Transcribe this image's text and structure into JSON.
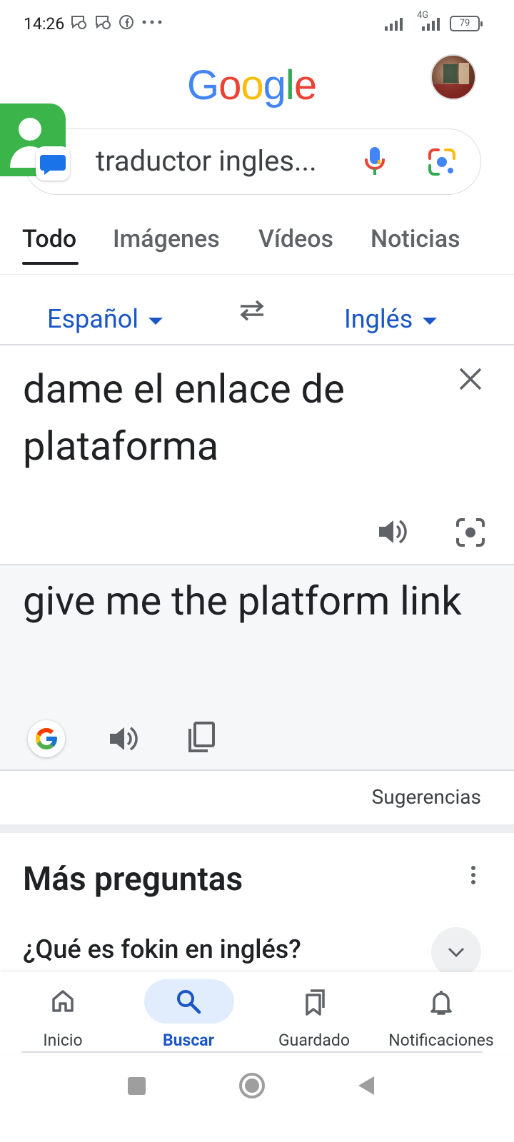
{
  "status_bar": {
    "time": "14:26",
    "network": "4G",
    "battery": "79"
  },
  "header": {
    "logo": "Google",
    "logo_colors": [
      "#4285F4",
      "#EA4335",
      "#FBBC05",
      "#4285F4",
      "#34A853",
      "#EA4335"
    ]
  },
  "search": {
    "query": "traductor ingles..."
  },
  "tabs": [
    {
      "label": "Todo",
      "active": true
    },
    {
      "label": "Imágenes"
    },
    {
      "label": "Vídeos"
    },
    {
      "label": "Noticias"
    }
  ],
  "translator": {
    "source_lang": "Español",
    "target_lang": "Inglés",
    "source_text": "dame el enlace de plataforma",
    "translated_text": "give me the platform link",
    "suggestions_label": "Sugerencias"
  },
  "more_questions": {
    "title": "Más preguntas",
    "items": [
      {
        "question": "¿Qué es fokin en inglés?"
      }
    ]
  },
  "bottom_nav": [
    {
      "label": "Inicio",
      "icon": "home-icon"
    },
    {
      "label": "Buscar",
      "icon": "search-icon",
      "active": true
    },
    {
      "label": "Guardado",
      "icon": "bookmarks-icon"
    },
    {
      "label": "Notificaciones",
      "icon": "bell-icon"
    }
  ],
  "colors": {
    "accent": "#1a56c6",
    "active_pill": "#e1ecfd",
    "panel_bg": "#f6f7f9"
  }
}
